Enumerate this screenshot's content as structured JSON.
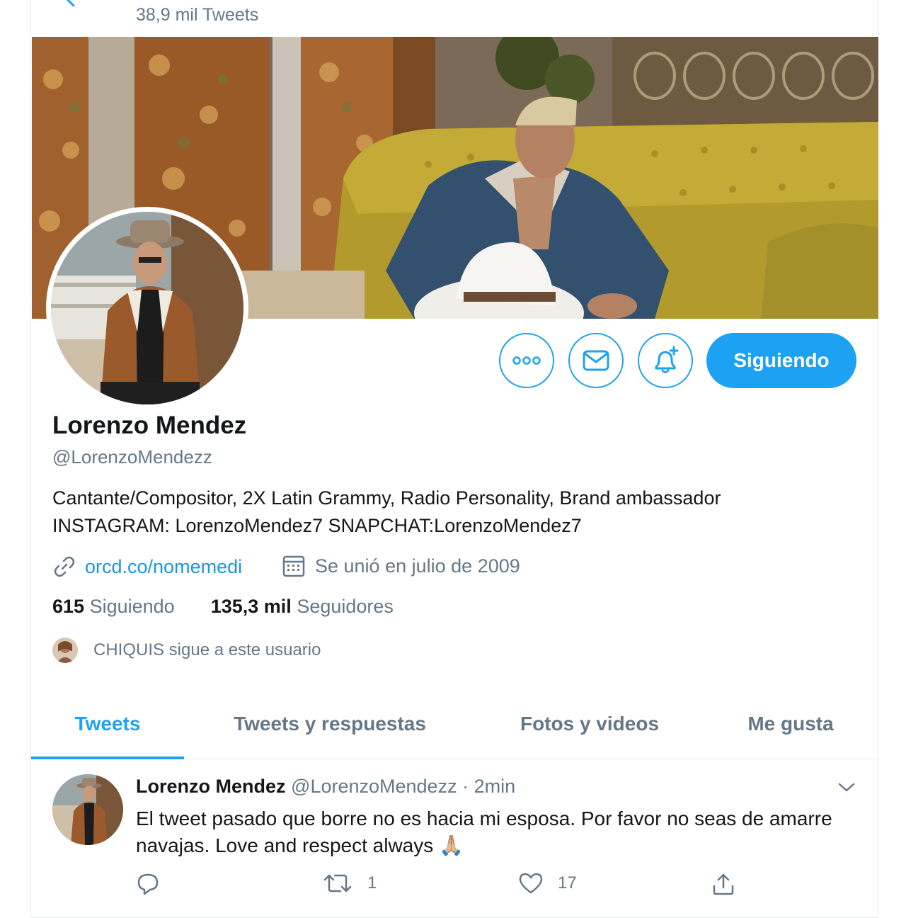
{
  "header": {
    "tweet_count": "38,9 mil Tweets"
  },
  "profile": {
    "name": "Lorenzo Mendez",
    "handle": "@LorenzoMendezz",
    "bio_line1": "Cantante/Compositor, 2X Latin Grammy, Radio Personality, Brand ambassador",
    "bio_line2": "INSTAGRAM: LorenzoMendez7 SNAPCHAT:LorenzoMendez7",
    "website": "orcd.co/nomemedi",
    "joined": "Se unió en julio de 2009",
    "following_count": "615",
    "following_label": "Siguiendo",
    "followers_count": "135,3 mil",
    "followers_label": "Seguidores",
    "followed_by": "CHIQUIS sigue a este usuario"
  },
  "actions": {
    "more_icon": "more-icon",
    "message_icon": "mail-icon",
    "notify_icon": "bell-plus-icon",
    "follow_label": "Siguiendo"
  },
  "tabs": [
    {
      "label": "Tweets",
      "active": true
    },
    {
      "label": "Tweets y respuestas",
      "active": false
    },
    {
      "label": "Fotos y videos",
      "active": false
    },
    {
      "label": "Me gusta",
      "active": false
    }
  ],
  "tweet": {
    "name": "Lorenzo Mendez",
    "handle": "@LorenzoMendezz",
    "separator": "·",
    "time": "2min",
    "text": "El tweet pasado que borre no es hacia mi esposa. Por favor no seas de amarre navajas. Love and respect always",
    "emoji": "🙏🏼",
    "reply_count": "",
    "retweet_count": "1",
    "like_count": "17"
  },
  "colors": {
    "accent": "#1da1f2",
    "link": "#1b95e0",
    "secondary_text": "#657786",
    "primary_text": "#14171a"
  }
}
